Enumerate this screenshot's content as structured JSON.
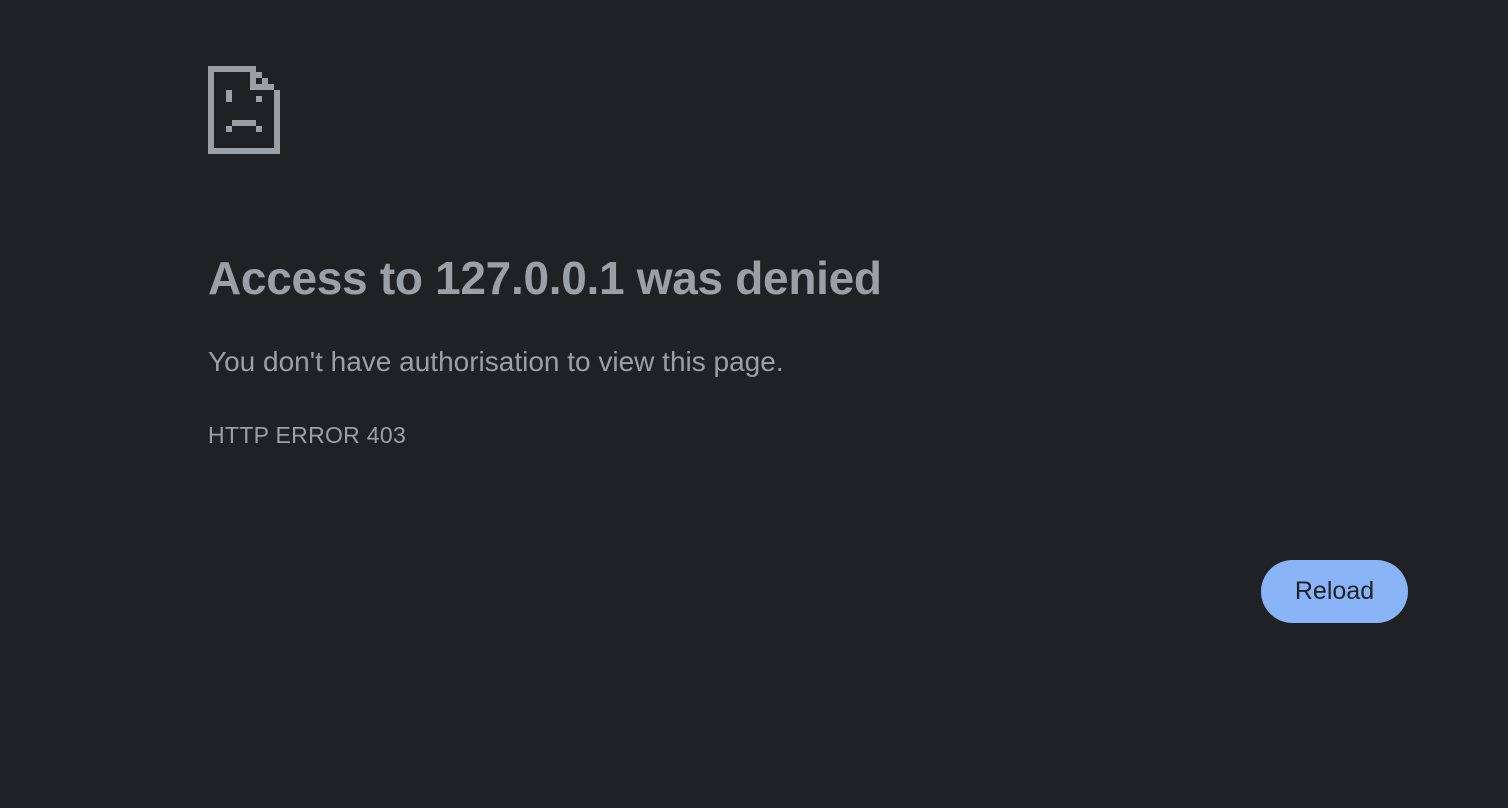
{
  "error_page": {
    "icon": "sad-page-icon",
    "title": "Access to 127.0.0.1 was denied",
    "message": "You don't have authorisation to view this page.",
    "error_code": "HTTP ERROR 403",
    "reload_label": "Reload"
  },
  "colors": {
    "background": "#202124",
    "text": "#9aa0a6",
    "icon": "#9aa0a6",
    "button_background": "#8ab4f8",
    "button_text": "#202124"
  }
}
